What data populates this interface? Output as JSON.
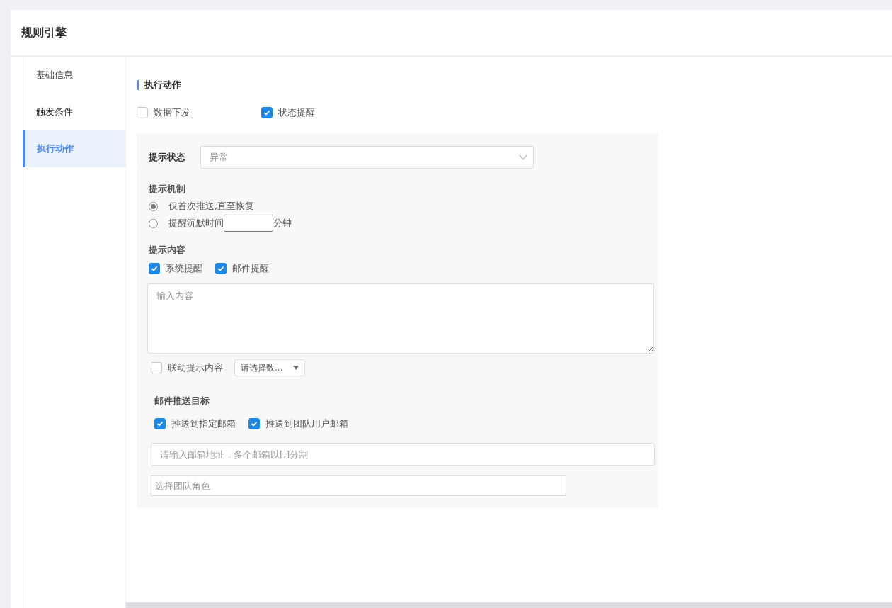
{
  "page": {
    "title": "规则引擎"
  },
  "sidebar": {
    "items": [
      {
        "label": "基础信息",
        "selected": false
      },
      {
        "label": "触发条件",
        "selected": false
      },
      {
        "label": "执行动作",
        "selected": true
      }
    ]
  },
  "section": {
    "title": "执行动作"
  },
  "actions": [
    {
      "label": "数据下发",
      "checked": false
    },
    {
      "label": "状态提醒",
      "checked": true
    }
  ],
  "status_field": {
    "label": "提示状态",
    "value": "异常"
  },
  "mechanism": {
    "label": "提示机制",
    "options": [
      {
        "kind": "text",
        "label": "仅首次推送,直至恢复",
        "selected": true
      },
      {
        "kind": "minutes",
        "label": "提醒沉默时间",
        "unit": "分钟",
        "selected": false
      }
    ]
  },
  "content": {
    "label": "提示内容",
    "channels": [
      {
        "label": "系统提醒",
        "checked": true
      },
      {
        "label": "邮件提醒",
        "checked": true
      }
    ],
    "textarea": {
      "placeholder": "输入内容"
    },
    "linked": {
      "label": "联动提示内容",
      "checked": false
    },
    "linked_select": {
      "value": "请选择数..."
    }
  },
  "email_target": {
    "label": "邮件推送目标",
    "options": [
      {
        "label": "推送到指定邮箱",
        "checked": true
      },
      {
        "label": "推送到团队用户邮箱",
        "checked": true
      }
    ],
    "address": {
      "placeholder": "请输入邮箱地址，多个邮箱以[,]分割"
    },
    "role": {
      "placeholder": "选择团队角色"
    }
  }
}
